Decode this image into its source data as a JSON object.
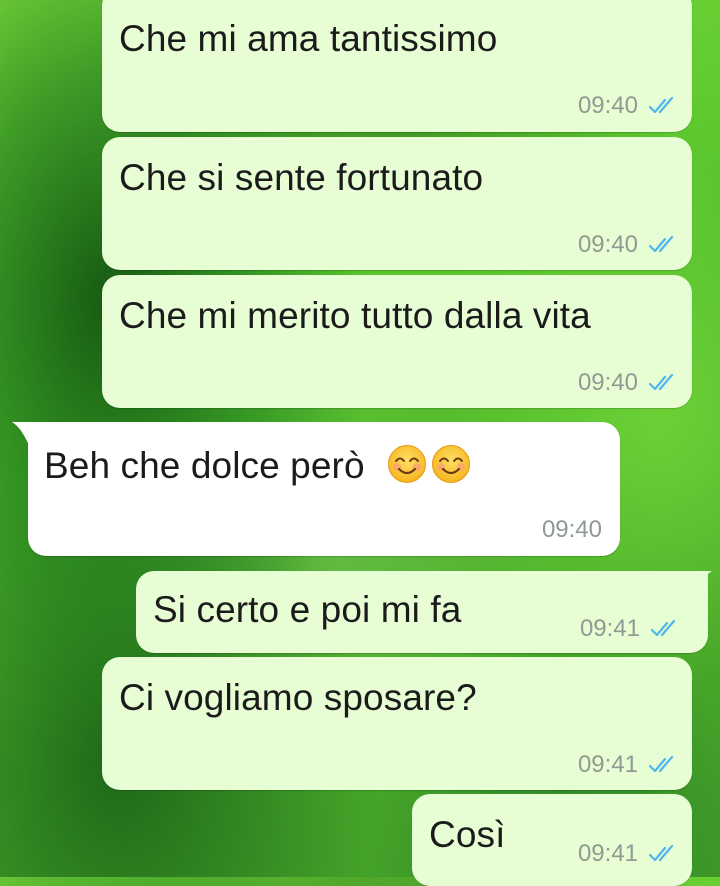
{
  "chat": {
    "messages": [
      {
        "text": "Che mi ama tantissimo",
        "time": "09:40",
        "direction": "outgoing",
        "status_icon": "double-check-read-icon"
      },
      {
        "text": "Che si sente fortunato",
        "time": "09:40",
        "direction": "outgoing",
        "status_icon": "double-check-read-icon"
      },
      {
        "text": "Che mi merito tutto dalla vita",
        "time": "09:40",
        "direction": "outgoing",
        "status_icon": "double-check-read-icon"
      },
      {
        "text": "Beh che dolce però",
        "emojis": [
          "smiling-face-emoji",
          "smiling-face-emoji"
        ],
        "time": "09:40",
        "direction": "incoming"
      },
      {
        "text": "Si certo e poi mi fa",
        "time": "09:41",
        "direction": "outgoing",
        "status_icon": "double-check-read-icon"
      },
      {
        "text": "Ci vogliamo sposare?",
        "time": "09:41",
        "direction": "outgoing",
        "status_icon": "double-check-read-icon"
      },
      {
        "text": "Così",
        "time": "09:41",
        "direction": "outgoing",
        "status_icon": "double-check-read-icon"
      }
    ]
  },
  "colors": {
    "outgoing_bubble": "#e7fdd4",
    "incoming_bubble": "#ffffff",
    "read_ticks": "#4fb6ec",
    "timestamp": "#8f9a92",
    "wallpaper": "#5cc82e"
  }
}
